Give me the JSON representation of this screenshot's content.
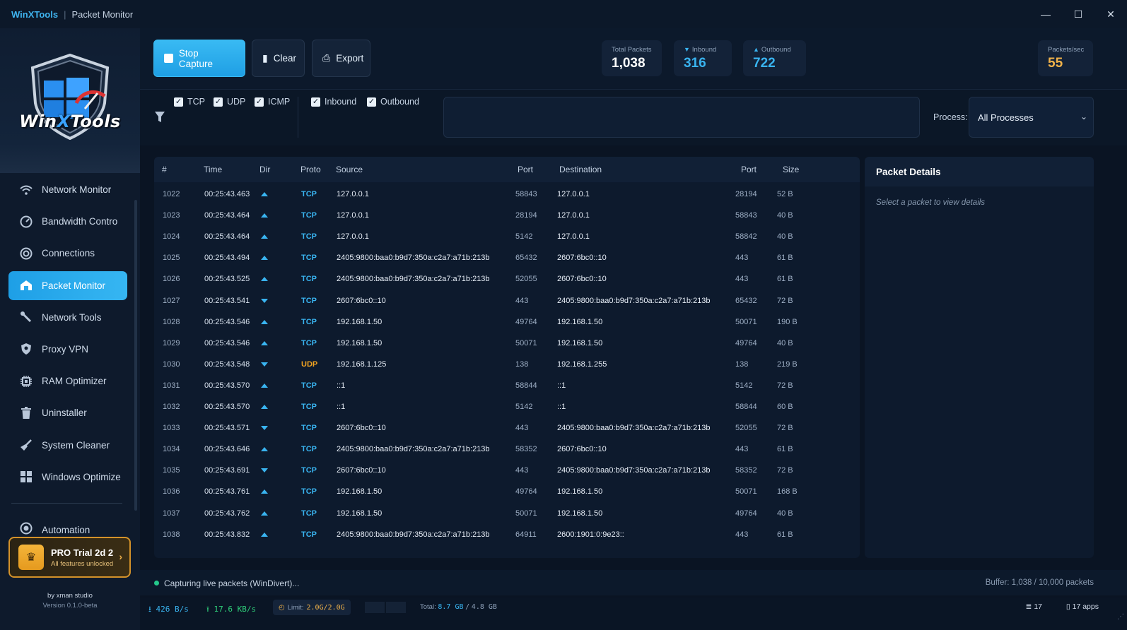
{
  "titlebar": {
    "brand": "WinXTools",
    "separator": "|",
    "title": "Packet Monitor",
    "minimize": "—",
    "maximize": "☐",
    "close": "✕"
  },
  "sidebar": {
    "logo_text_1": "Win",
    "logo_text_2": "X",
    "logo_text_3": "Tools",
    "items": [
      {
        "label": "Network Monitor",
        "icon": "wifi-icon",
        "glyph": "≡"
      },
      {
        "label": "Bandwidth Contro",
        "icon": "gauge-icon",
        "glyph": "◔"
      },
      {
        "label": "Connections",
        "icon": "target-icon",
        "glyph": "◎"
      },
      {
        "label": "Packet Monitor",
        "icon": "box-icon",
        "glyph": "⌂",
        "active": true
      },
      {
        "label": "Network Tools",
        "icon": "wrench-icon",
        "glyph": "⚒"
      },
      {
        "label": "Proxy VPN",
        "icon": "shield-icon",
        "glyph": "◈"
      },
      {
        "label": "RAM Optimizer",
        "icon": "chip-icon",
        "glyph": "▣"
      },
      {
        "label": "Uninstaller",
        "icon": "trash-icon",
        "glyph": "▮"
      },
      {
        "label": "System Cleaner",
        "icon": "broom-icon",
        "glyph": "✦"
      },
      {
        "label": "Windows Optimize",
        "icon": "windows-icon",
        "glyph": "⊞"
      }
    ],
    "automation": "Automation",
    "pro": {
      "title": "PRO Trial  2d  2",
      "sub": "All features unlocked",
      "badge": "♛",
      "arrow": "›"
    },
    "credit": "by xman studio",
    "version": "Version 0.1.0-beta"
  },
  "toolbar": {
    "stop_label": "Stop Capture",
    "clear_label": "Clear",
    "export_label": "Export",
    "clear_icon": "▮",
    "export_icon": "⎙"
  },
  "stats": {
    "total_label": "Total Packets",
    "total_value": "1,038",
    "inbound_label": "Inbound",
    "inbound_value": "316",
    "outbound_label": "Outbound",
    "outbound_value": "722",
    "rate_label": "Packets/sec",
    "rate_value": "55",
    "down_arrow": "▼",
    "up_arrow": "▲"
  },
  "filters": {
    "check": "✓",
    "tcp": "TCP",
    "udp": "UDP",
    "icmp": "ICMP",
    "inbound": "Inbound",
    "outbound": "Outbound",
    "search_value": "",
    "process_label": "Process:",
    "process_value": "All Processes",
    "chevron": "⌄"
  },
  "table": {
    "headers": {
      "num": "#",
      "time": "Time",
      "dir": "Dir",
      "proto": "Proto",
      "source": "Source",
      "sport": "Port",
      "dest": "Destination",
      "dport": "Port",
      "size": "Size"
    },
    "rows": [
      {
        "num": "1022",
        "time": "00:25:43.463",
        "dir": "up",
        "proto": "TCP",
        "source": "127.0.0.1",
        "sport": "58843",
        "dest": "127.0.0.1",
        "dport": "28194",
        "size": "52 B"
      },
      {
        "num": "1023",
        "time": "00:25:43.464",
        "dir": "up",
        "proto": "TCP",
        "source": "127.0.0.1",
        "sport": "28194",
        "dest": "127.0.0.1",
        "dport": "58843",
        "size": "40 B"
      },
      {
        "num": "1024",
        "time": "00:25:43.464",
        "dir": "up",
        "proto": "TCP",
        "source": "127.0.0.1",
        "sport": "5142",
        "dest": "127.0.0.1",
        "dport": "58842",
        "size": "40 B"
      },
      {
        "num": "1025",
        "time": "00:25:43.494",
        "dir": "up",
        "proto": "TCP",
        "source": "2405:9800:baa0:b9d7:350a:c2a7:a71b:213b",
        "sport": "65432",
        "dest": "2607:6bc0::10",
        "dport": "443",
        "size": "61 B"
      },
      {
        "num": "1026",
        "time": "00:25:43.525",
        "dir": "up",
        "proto": "TCP",
        "source": "2405:9800:baa0:b9d7:350a:c2a7:a71b:213b",
        "sport": "52055",
        "dest": "2607:6bc0::10",
        "dport": "443",
        "size": "61 B"
      },
      {
        "num": "1027",
        "time": "00:25:43.541",
        "dir": "down",
        "proto": "TCP",
        "source": "2607:6bc0::10",
        "sport": "443",
        "dest": "2405:9800:baa0:b9d7:350a:c2a7:a71b:213b",
        "dport": "65432",
        "size": "72 B"
      },
      {
        "num": "1028",
        "time": "00:25:43.546",
        "dir": "up",
        "proto": "TCP",
        "source": "192.168.1.50",
        "sport": "49764",
        "dest": "192.168.1.50",
        "dport": "50071",
        "size": "190 B"
      },
      {
        "num": "1029",
        "time": "00:25:43.546",
        "dir": "up",
        "proto": "TCP",
        "source": "192.168.1.50",
        "sport": "50071",
        "dest": "192.168.1.50",
        "dport": "49764",
        "size": "40 B"
      },
      {
        "num": "1030",
        "time": "00:25:43.548",
        "dir": "down",
        "proto": "UDP",
        "source": "192.168.1.125",
        "sport": "138",
        "dest": "192.168.1.255",
        "dport": "138",
        "size": "219 B"
      },
      {
        "num": "1031",
        "time": "00:25:43.570",
        "dir": "up",
        "proto": "TCP",
        "source": "::1",
        "sport": "58844",
        "dest": "::1",
        "dport": "5142",
        "size": "72 B"
      },
      {
        "num": "1032",
        "time": "00:25:43.570",
        "dir": "up",
        "proto": "TCP",
        "source": "::1",
        "sport": "5142",
        "dest": "::1",
        "dport": "58844",
        "size": "60 B"
      },
      {
        "num": "1033",
        "time": "00:25:43.571",
        "dir": "down",
        "proto": "TCP",
        "source": "2607:6bc0::10",
        "sport": "443",
        "dest": "2405:9800:baa0:b9d7:350a:c2a7:a71b:213b",
        "dport": "52055",
        "size": "72 B"
      },
      {
        "num": "1034",
        "time": "00:25:43.646",
        "dir": "up",
        "proto": "TCP",
        "source": "2405:9800:baa0:b9d7:350a:c2a7:a71b:213b",
        "sport": "58352",
        "dest": "2607:6bc0::10",
        "dport": "443",
        "size": "61 B"
      },
      {
        "num": "1035",
        "time": "00:25:43.691",
        "dir": "down",
        "proto": "TCP",
        "source": "2607:6bc0::10",
        "sport": "443",
        "dest": "2405:9800:baa0:b9d7:350a:c2a7:a71b:213b",
        "dport": "58352",
        "size": "72 B"
      },
      {
        "num": "1036",
        "time": "00:25:43.761",
        "dir": "up",
        "proto": "TCP",
        "source": "192.168.1.50",
        "sport": "49764",
        "dest": "192.168.1.50",
        "dport": "50071",
        "size": "168 B"
      },
      {
        "num": "1037",
        "time": "00:25:43.762",
        "dir": "up",
        "proto": "TCP",
        "source": "192.168.1.50",
        "sport": "50071",
        "dest": "192.168.1.50",
        "dport": "49764",
        "size": "40 B"
      },
      {
        "num": "1038",
        "time": "00:25:43.832",
        "dir": "up",
        "proto": "TCP",
        "source": "2405:9800:baa0:b9d7:350a:c2a7:a71b:213b",
        "sport": "64911",
        "dest": "2600:1901:0:9e23::",
        "dport": "443",
        "size": "61 B"
      }
    ]
  },
  "details": {
    "title": "Packet Details",
    "hint": "Select a packet to view details"
  },
  "status": {
    "text": "Capturing live packets (WinDivert)...",
    "buffer": "Buffer: 1,038 / 10,000 packets"
  },
  "bottom": {
    "down_arrow": "⭳",
    "down_rate": "426 B/s",
    "up_arrow": "⭱",
    "up_rate": "17.6 KB/s",
    "limit_icon": "◴",
    "limit_label": "Limit:",
    "limit_value": "2.0G/2.0G",
    "total_label": "Total:",
    "total_used": "8.7 GB",
    "total_sep": "/",
    "total_cap": "4.8 GB",
    "wifi_icon": "≣",
    "wifi_count": "17",
    "apps_icon": "▯",
    "apps_count": "17 apps",
    "grip": "⋰"
  },
  "colors": {
    "accent": "#39b4f0",
    "udp": "#f0a321",
    "pro_border": "#d4922a",
    "status_dot": "#24c98b",
    "rate_value": "#f0b24a"
  }
}
